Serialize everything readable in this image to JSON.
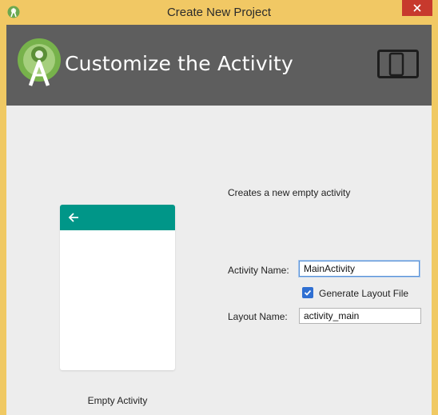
{
  "titlebar": {
    "title": "Create New Project",
    "icon": "android-studio-icon",
    "close_icon": "close-icon"
  },
  "header": {
    "title": "Customize the Activity",
    "logo": "android-studio-logo",
    "device_icon": "devices-icon"
  },
  "preview": {
    "template_name": "Empty Activity",
    "appbar_color": "#009688",
    "back_icon": "arrow-back-icon"
  },
  "form": {
    "description": "Creates a new empty activity",
    "activity_name_label": "Activity Name:",
    "activity_name_value": "MainActivity",
    "generate_layout_label": "Generate Layout File",
    "generate_layout_checked": true,
    "layout_name_label": "Layout Name:",
    "layout_name_value": "activity_main"
  },
  "colors": {
    "window_frame": "#f1c864",
    "header_bg": "#5e5e5e",
    "body_bg": "#ededed",
    "close_button": "#c7392d",
    "accent": "#2f6fd2"
  }
}
